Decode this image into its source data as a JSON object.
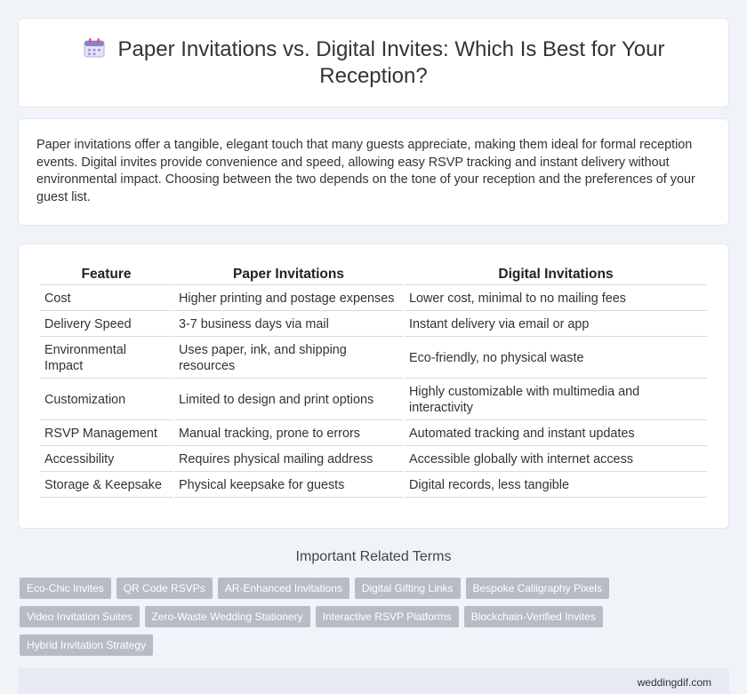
{
  "header": {
    "icon": "calendar-icon",
    "title": "Paper Invitations vs. Digital Invites: Which Is Best for Your Reception?"
  },
  "summary": {
    "text": "Paper invitations offer a tangible, elegant touch that many guests appreciate, making them ideal for formal reception events. Digital invites provide convenience and speed, allowing easy RSVP tracking and instant delivery without environmental impact. Choosing between the two depends on the tone of your reception and the preferences of your guest list."
  },
  "table": {
    "headers": [
      "Feature",
      "Paper Invitations",
      "Digital Invitations"
    ],
    "rows": [
      [
        "Cost",
        "Higher printing and postage expenses",
        "Lower cost, minimal to no mailing fees"
      ],
      [
        "Delivery Speed",
        "3-7 business days via mail",
        "Instant delivery via email or app"
      ],
      [
        "Environmental Impact",
        "Uses paper, ink, and shipping resources",
        "Eco-friendly, no physical waste"
      ],
      [
        "Customization",
        "Limited to design and print options",
        "Highly customizable with multimedia and interactivity"
      ],
      [
        "RSVP Management",
        "Manual tracking, prone to errors",
        "Automated tracking and instant updates"
      ],
      [
        "Accessibility",
        "Requires physical mailing address",
        "Accessible globally with internet access"
      ],
      [
        "Storage & Keepsake",
        "Physical keepsake for guests",
        "Digital records, less tangible"
      ]
    ]
  },
  "terms": {
    "title": "Important Related Terms",
    "items": [
      "Eco-Chic Invites",
      "QR Code RSVPs",
      "AR-Enhanced Invitations",
      "Digital Gifting Links",
      "Bespoke Calligraphy Pixels",
      "Video Invitation Suites",
      "Zero-Waste Wedding Stationery",
      "Interactive RSVP Platforms",
      "Blockchain-Verified Invites",
      "Hybrid Invitation Strategy"
    ]
  },
  "footer": {
    "site": "weddingdif.com"
  }
}
